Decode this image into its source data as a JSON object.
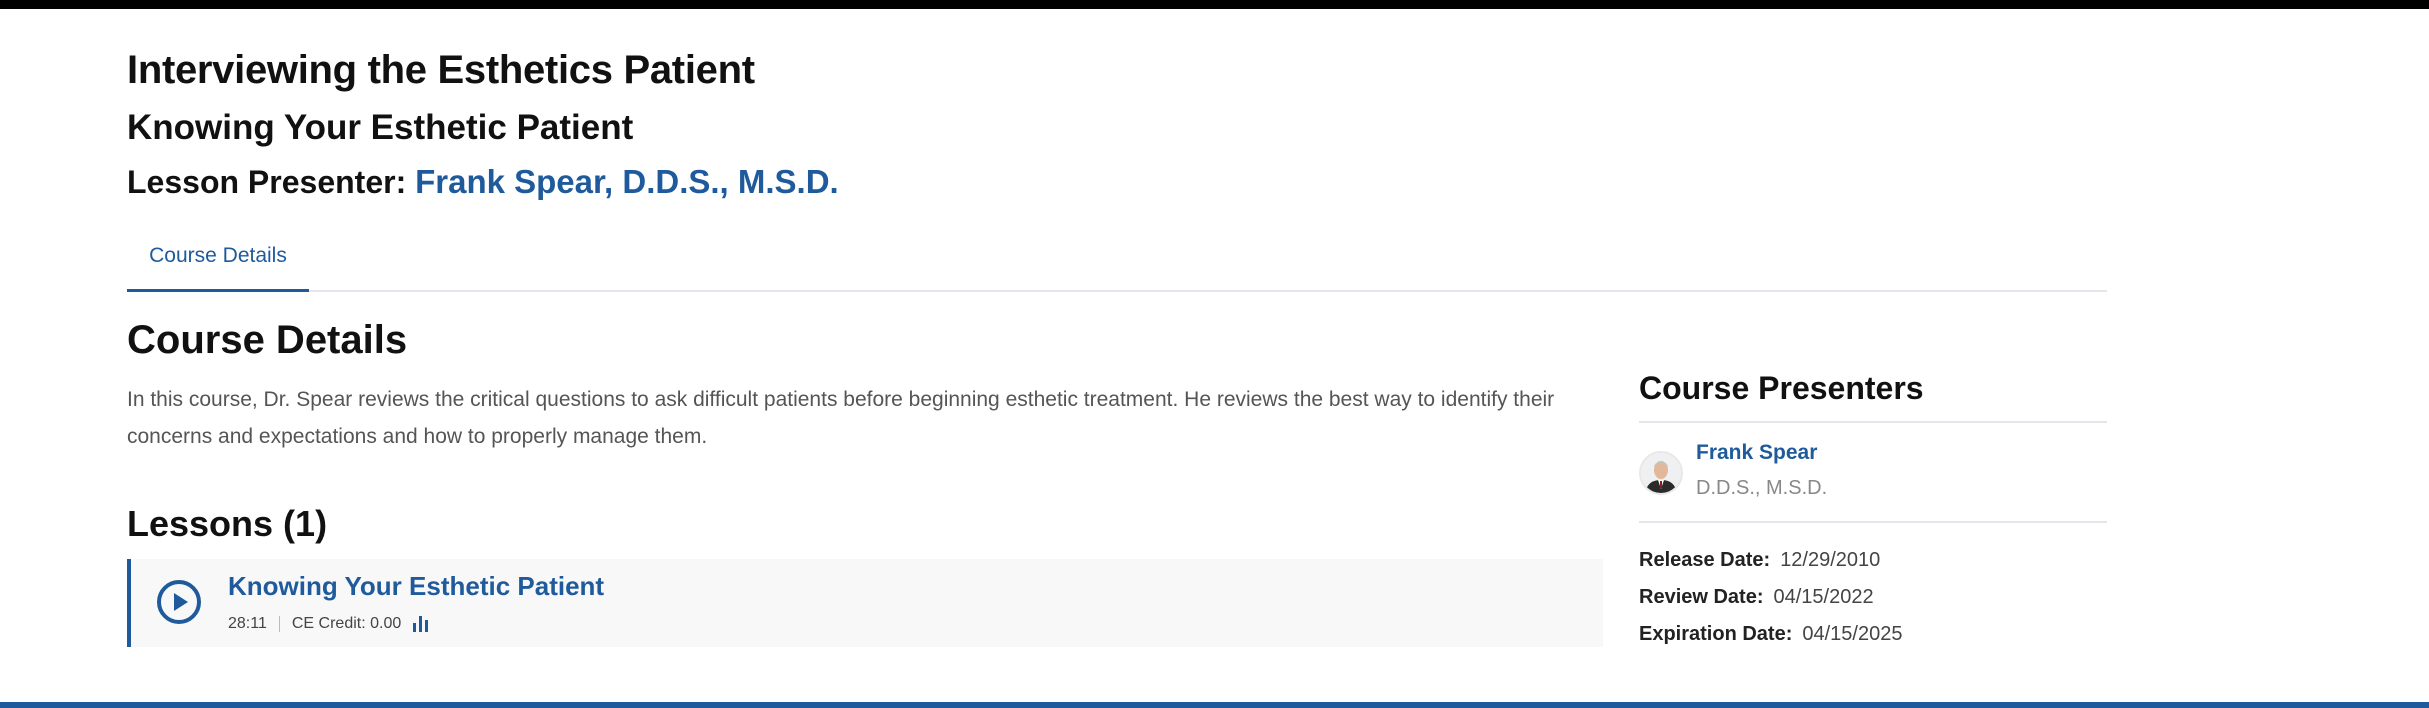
{
  "header": {
    "course_title": "Interviewing the Esthetics Patient",
    "lesson_title": "Knowing Your Esthetic Patient",
    "presenter_label": "Lesson Presenter:",
    "presenter_name": "Frank Spear, D.D.S., M.S.D."
  },
  "tabs": [
    {
      "label": "Course Details",
      "active": true
    }
  ],
  "details": {
    "heading": "Course Details",
    "description": "In this course, Dr. Spear reviews the critical questions to ask difficult patients before beginning esthetic treatment. He reviews the best way to identify their concerns and expectations and how to properly manage them."
  },
  "lessons": {
    "heading": "Lessons (1)",
    "items": [
      {
        "title": "Knowing Your Esthetic Patient",
        "duration": "28:11",
        "ce_credit": "CE Credit: 0.00",
        "play_icon": "play-circle-icon",
        "stats_icon": "bar-chart-icon"
      }
    ]
  },
  "sidebar": {
    "presenters_heading": "Course Presenters",
    "presenters": [
      {
        "name": "Frank Spear",
        "credentials": "D.D.S., M.S.D."
      }
    ],
    "dates": [
      {
        "label": "Release Date:",
        "value": "12/29/2010"
      },
      {
        "label": "Review Date:",
        "value": "04/15/2022"
      },
      {
        "label": "Expiration Date:",
        "value": "04/15/2025"
      }
    ]
  },
  "colors": {
    "accent": "#1f5b9c",
    "top_bar": "#000000",
    "text": "#111111",
    "muted": "#555555",
    "card_bg": "#f8f8f8"
  }
}
